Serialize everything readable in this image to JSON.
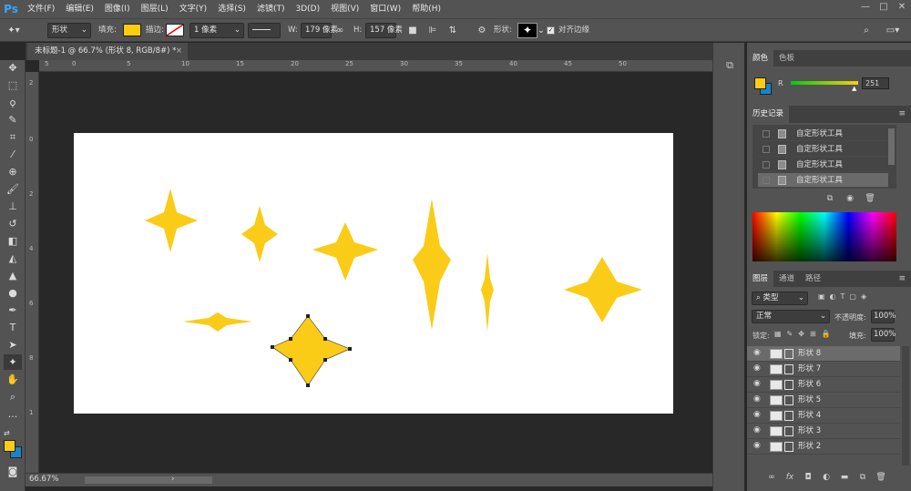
{
  "app": {
    "logo": "Ps"
  },
  "menu": [
    "文件(F)",
    "编辑(E)",
    "图像(I)",
    "图层(L)",
    "文字(Y)",
    "选择(S)",
    "滤镜(T)",
    "3D(D)",
    "视图(V)",
    "窗口(W)",
    "帮助(H)"
  ],
  "window_controls": {
    "minimize": "—",
    "restore": "□",
    "close": "✕"
  },
  "options": {
    "mode": "形状",
    "fill_label": "填充:",
    "stroke_label": "描边:",
    "stroke_width": "1 像素",
    "w_label": "W:",
    "w_value": "179 像素",
    "h_label": "H:",
    "h_value": "157 像素",
    "shape_label": "形状:",
    "align_edges_label": "对齐边缘",
    "fill_color": "#ffcc11"
  },
  "document": {
    "tab_title": "未标题-1 @ 66.7% (形状 8, RGB/8#) *",
    "zoom": "66.67%",
    "shape_color": "#fbcc17"
  },
  "rulers": {
    "h": [
      "5",
      "0",
      "5",
      "10",
      "15",
      "20",
      "25",
      "30",
      "35",
      "40",
      "45",
      "50"
    ],
    "v": [
      "2",
      "0",
      "2",
      "4",
      "6",
      "8",
      "1"
    ]
  },
  "color_panel": {
    "tabs": [
      "颜色",
      "色板"
    ],
    "channel_label": "R",
    "channel_value": "251",
    "fg": "#ffcc11",
    "bg": "#1a84c8"
  },
  "history_panel": {
    "tab": "历史记录",
    "items": [
      "自定形状工具",
      "自定形状工具",
      "自定形状工具",
      "自定形状工具"
    ]
  },
  "layers_panel": {
    "tabs": [
      "图层",
      "通道",
      "路径"
    ],
    "filter_kind": "类型",
    "blend_mode": "正常",
    "opacity_label": "不透明度:",
    "opacity_value": "100%",
    "lock_label": "锁定:",
    "fill_label": "填充:",
    "fill_value": "100%",
    "layers": [
      "形状 8",
      "形状 7",
      "形状 6",
      "形状 5",
      "形状 4",
      "形状 3",
      "形状 2"
    ]
  }
}
